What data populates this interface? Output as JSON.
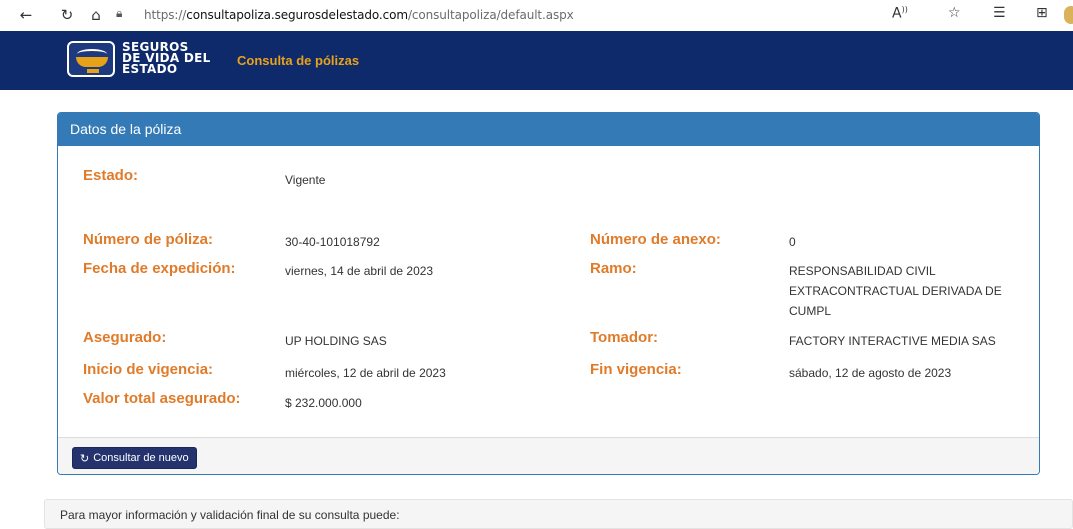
{
  "browser": {
    "url_prefix": "https://",
    "url_host": "consultapoliza.segurosdelestado.com",
    "url_path": "/consultapoliza/default.aspx"
  },
  "header": {
    "brand_line1": "SEGUROS",
    "brand_line2": "DE VIDA DEL",
    "brand_line3": "ESTADO",
    "title": "Consulta de pólizas"
  },
  "panel": {
    "heading": "Datos de la póliza",
    "estado": {
      "label": "Estado:",
      "value": "Vigente"
    },
    "numero_poliza": {
      "label": "Número de póliza:",
      "value": "30-40-101018792"
    },
    "numero_anexo": {
      "label": "Número de anexo:",
      "value": "0"
    },
    "fecha_expedicion": {
      "label": "Fecha de expedición:",
      "value": "viernes, 14 de abril de 2023"
    },
    "ramo": {
      "label": "Ramo:",
      "value": "RESPONSABILIDAD CIVIL EXTRACONTRACTUAL DERIVADA DE CUMPL"
    },
    "asegurado": {
      "label": "Asegurado:",
      "value": "UP HOLDING SAS"
    },
    "tomador": {
      "label": "Tomador:",
      "value": "FACTORY INTERACTIVE MEDIA SAS"
    },
    "inicio_vigencia": {
      "label": "Inicio de vigencia:",
      "value": "miércoles, 12 de abril de 2023"
    },
    "fin_vigencia": {
      "label": "Fin vigencia:",
      "value": "sábado, 12 de agosto de 2023"
    },
    "valor_total": {
      "label": "Valor total asegurado:",
      "value": "$ 232.000.000"
    },
    "button_label": "Consultar de nuevo"
  },
  "info": {
    "text": "Para mayor información y validación final de su consulta puede:"
  },
  "colors": {
    "header_bg": "#0f2a6b",
    "panel_heading_bg": "#337ab7",
    "label_orange": "#e07b2a",
    "button_bg": "#24336e"
  },
  "icons": [
    "back-icon",
    "reload-icon",
    "home-icon",
    "lock-icon",
    "read-aloud-icon",
    "favorite-add-icon",
    "favorites-icon",
    "collections-icon",
    "refresh-icon"
  ]
}
